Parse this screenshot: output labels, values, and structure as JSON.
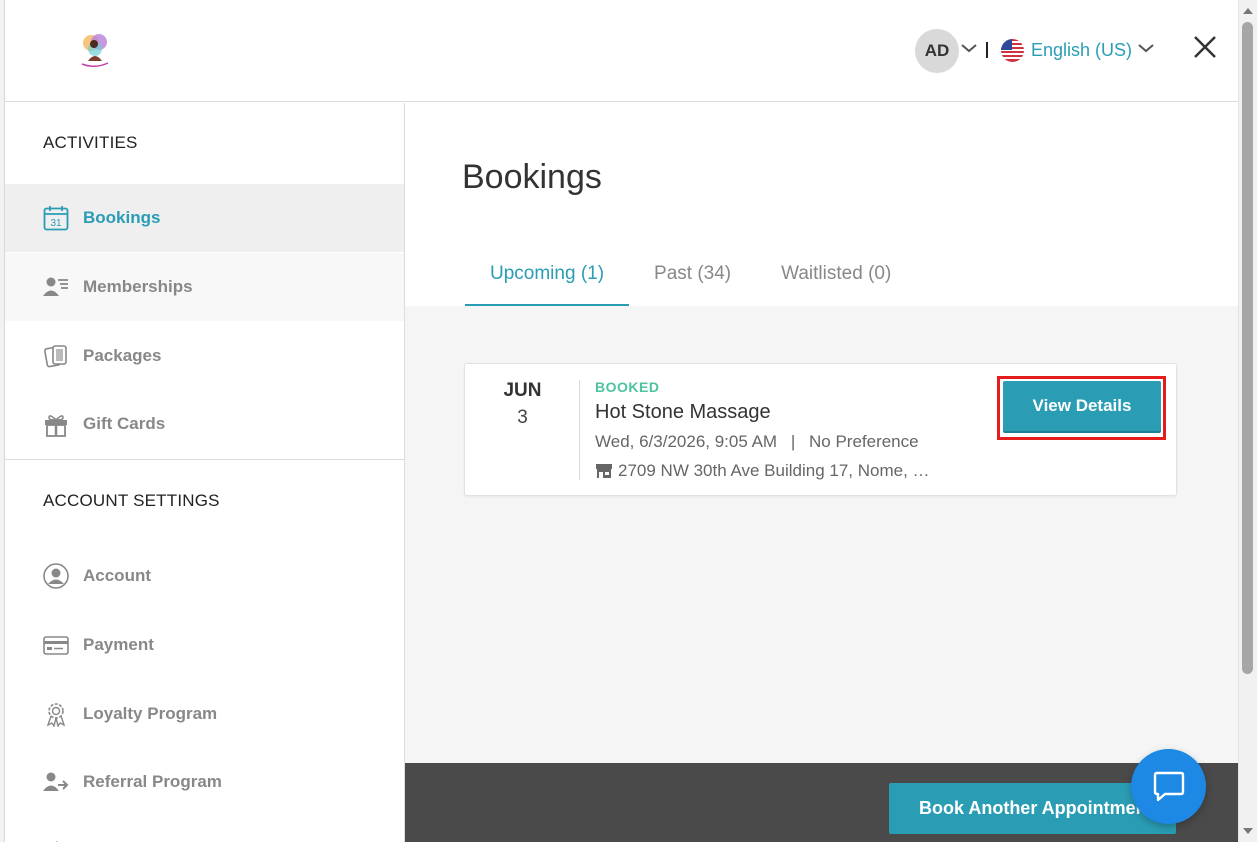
{
  "header": {
    "avatar_initials": "AD",
    "language": "English (US)",
    "accent_color": "#2a9db5"
  },
  "sidebar": {
    "activities_title": "ACTIVITIES",
    "activities": [
      {
        "label": "Bookings",
        "icon": "calendar-icon",
        "calendar_number": "31",
        "active": true
      },
      {
        "label": "Memberships",
        "icon": "membership-icon"
      },
      {
        "label": "Packages",
        "icon": "packages-icon"
      },
      {
        "label": "Gift Cards",
        "icon": "gift-icon"
      }
    ],
    "account_title": "ACCOUNT SETTINGS",
    "account": [
      {
        "label": "Account",
        "icon": "user-circle-icon"
      },
      {
        "label": "Payment",
        "icon": "credit-card-icon"
      },
      {
        "label": "Loyalty Program",
        "icon": "award-icon"
      },
      {
        "label": "Referral Program",
        "icon": "referral-icon"
      }
    ]
  },
  "main": {
    "title": "Bookings",
    "tabs": [
      {
        "label": "Upcoming (1)",
        "active": true
      },
      {
        "label": "Past (34)"
      },
      {
        "label": "Waitlisted (0)"
      }
    ],
    "booking": {
      "month": "JUN",
      "day": "3",
      "status": "BOOKED",
      "service": "Hot Stone Massage",
      "datetime": "Wed, 6/3/2026, 9:05 AM",
      "separator": "|",
      "staff": "No Preference",
      "address": "2709 NW 30th Ave Building 17, Nome, …",
      "view_details_label": "View Details"
    },
    "book_another_label": "Book Another Appointment"
  },
  "colors": {
    "accent": "#2a9db5",
    "booked_status": "#4ec3a0",
    "highlight_outline": "#e41c1c",
    "chat_button": "#1e88e5",
    "footer_bar": "#4a4a4a"
  }
}
